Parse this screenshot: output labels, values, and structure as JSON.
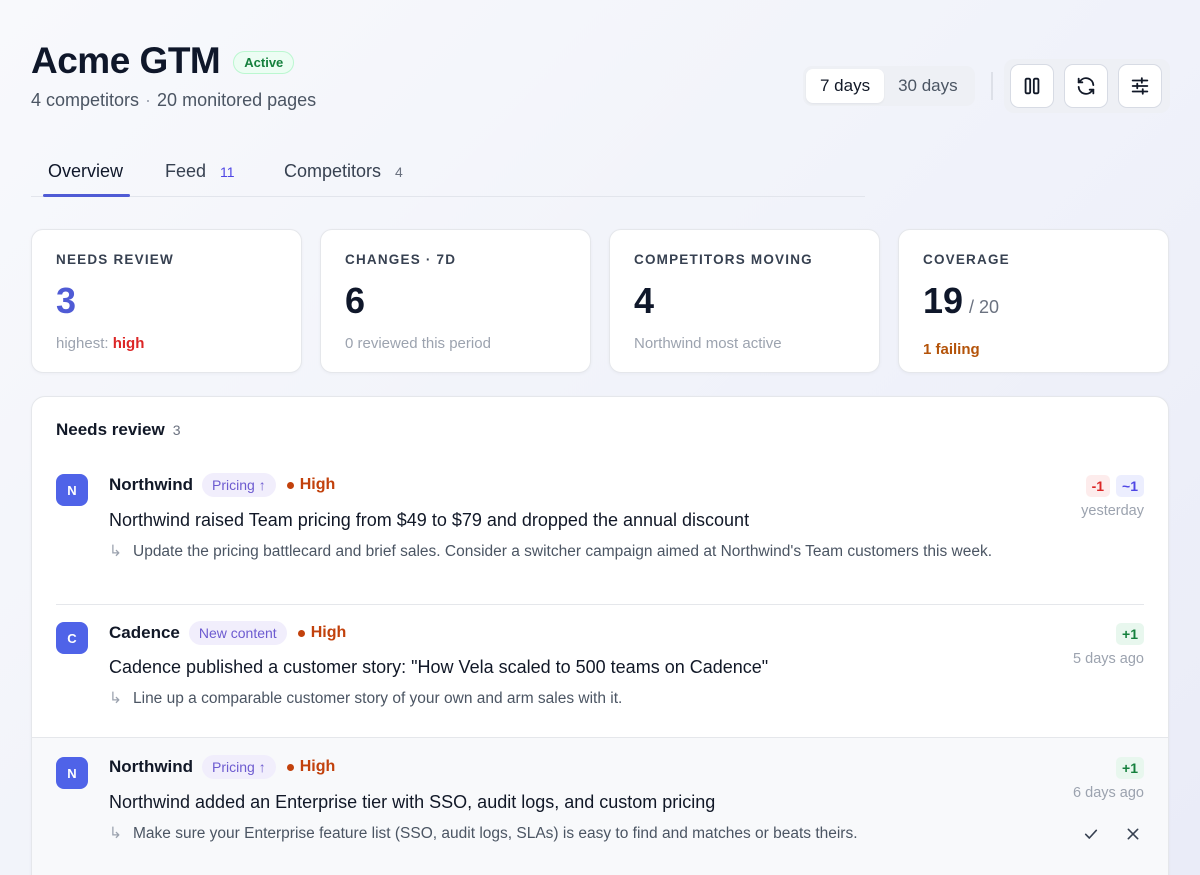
{
  "header": {
    "title": "Acme GTM",
    "status": "Active",
    "competitors_text": "4 competitors",
    "pages_text": "20 monitored pages",
    "separator": "·"
  },
  "range": {
    "options": [
      "7 days",
      "30 days"
    ],
    "selected": "7 days"
  },
  "toolbar_icons": [
    "columns-icon",
    "refresh-icon",
    "sliders-icon"
  ],
  "tabs": [
    {
      "label": "Overview",
      "count": ""
    },
    {
      "label": "Feed",
      "count": "11"
    },
    {
      "label": "Competitors",
      "count": "4"
    }
  ],
  "stats": {
    "needs_review": {
      "label": "NEEDS REVIEW",
      "value": "3",
      "note_prefix": "highest: ",
      "note_value": "high"
    },
    "changes": {
      "label": "CHANGES · 7D",
      "value": "6",
      "note": "0 reviewed this period"
    },
    "moving": {
      "label": "COMPETITORS MOVING",
      "value": "4",
      "note": "Northwind most active"
    },
    "coverage": {
      "label": "COVERAGE",
      "value": "19",
      "of": "/ 20",
      "note": "1 failing"
    }
  },
  "review": {
    "title": "Needs review",
    "count": "3",
    "items": [
      {
        "initial": "N",
        "competitor": "Northwind",
        "tag": "Pricing ↑",
        "severity": "High",
        "headline": "Northwind raised Team pricing from $49 to $79 and dropped the annual discount",
        "action": "Update the pricing battlecard and brief sales. Consider a switcher campaign aimed at Northwind's Team customers this week.",
        "deltas": [
          "-1",
          "~1"
        ],
        "when": "yesterday"
      },
      {
        "initial": "C",
        "competitor": "Cadence",
        "tag": "New content",
        "severity": "High",
        "headline": "Cadence published a customer story: \"How Vela scaled to 500 teams on Cadence\"",
        "action": "Line up a comparable customer story of your own and arm sales with it.",
        "deltas": [
          "+1"
        ],
        "when": "5 days ago"
      },
      {
        "initial": "N",
        "competitor": "Northwind",
        "tag": "Pricing ↑",
        "severity": "High",
        "headline": "Northwind added an Enterprise tier with SSO, audit logs, and custom pricing",
        "action": "Make sure your Enterprise feature list (SSO, audit logs, SLAs) is easy to find and matches or beats theirs.",
        "deltas": [
          "+1"
        ],
        "when": "6 days ago"
      }
    ]
  },
  "arrow_glyph": "↳",
  "colors": {
    "accent": "#4f5bd5",
    "active_badge": "#15803d",
    "severity_high": "#c2410c",
    "danger": "#dc2626",
    "warning": "#b45309"
  }
}
